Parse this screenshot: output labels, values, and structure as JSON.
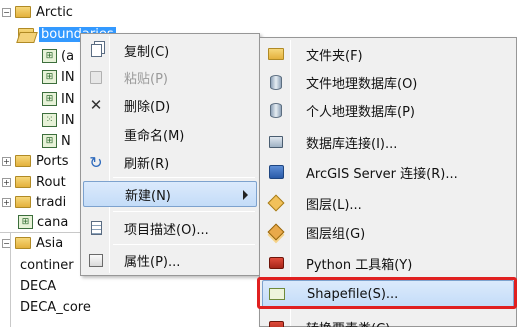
{
  "tree": {
    "items": [
      {
        "label": "Arctic",
        "expander": "-",
        "icon": "folder-icon"
      },
      {
        "label": "boundaries",
        "icon": "open-folder-icon",
        "selected": true
      },
      {
        "label": "(a",
        "icon": "feature-class-icon"
      },
      {
        "label": "IN",
        "icon": "feature-class-icon"
      },
      {
        "label": "IN",
        "icon": "feature-class-icon"
      },
      {
        "label": "IN",
        "icon": "point-feature-class-icon"
      },
      {
        "label": "N",
        "icon": "feature-class-icon"
      },
      {
        "label": "Ports",
        "expander": "+",
        "icon": "folder-icon"
      },
      {
        "label": "Rout",
        "expander": "+",
        "icon": "folder-icon"
      },
      {
        "label": "tradi",
        "expander": "+",
        "icon": "folder-icon"
      },
      {
        "label": "cana",
        "icon": "feature-class-icon"
      },
      {
        "label": "Asia",
        "expander": "-",
        "icon": "folder-icon"
      },
      {
        "label": "continer",
        "icon": ""
      },
      {
        "label": "DECA",
        "icon": ""
      },
      {
        "label": "DECA_core",
        "icon": ""
      }
    ]
  },
  "context_menu": {
    "items": [
      {
        "label": "复制(C)",
        "icon": "copy-icon",
        "disabled": false
      },
      {
        "label": "粘贴(P)",
        "icon": "paste-icon",
        "disabled": true
      },
      {
        "label": "删除(D)",
        "icon": "delete-icon",
        "disabled": false
      },
      {
        "label": "重命名(M)",
        "icon": "",
        "disabled": false
      },
      {
        "label": "刷新(R)",
        "icon": "refresh-icon",
        "disabled": false
      },
      {
        "label": "新建(N)",
        "icon": "",
        "disabled": false,
        "highlighted": true,
        "submenu": true
      },
      {
        "label": "项目描述(O)...",
        "icon": "description-icon",
        "disabled": false
      },
      {
        "label": "属性(P)...",
        "icon": "properties-icon",
        "disabled": false
      }
    ]
  },
  "new_submenu": {
    "items": [
      {
        "label": "文件夹(F)",
        "icon": "folder-icon"
      },
      {
        "label": "文件地理数据库(O)",
        "icon": "file-geodatabase-icon"
      },
      {
        "label": "个人地理数据库(P)",
        "icon": "personal-geodatabase-icon"
      },
      {
        "label": "数据库连接(I)...",
        "icon": "database-connection-icon"
      },
      {
        "label": "ArcGIS Server 连接(R)...",
        "icon": "arcgis-server-icon"
      },
      {
        "label": "图层(L)...",
        "icon": "layer-icon"
      },
      {
        "label": "图层组(G)",
        "icon": "group-layer-icon"
      },
      {
        "label": "Python 工具箱(Y)",
        "icon": "python-toolbox-icon"
      },
      {
        "label": "Shapefile(S)...",
        "icon": "shapefile-icon",
        "highlighted": true,
        "annotated": true
      },
      {
        "label": "转换要素类(C)",
        "icon": "toolbox-icon",
        "partial": true
      }
    ]
  },
  "colors": {
    "selection": "#3399ff",
    "menu_background": "#f0f0f0",
    "highlight": "#c4dcf8",
    "annotation_box": "#e02020"
  }
}
